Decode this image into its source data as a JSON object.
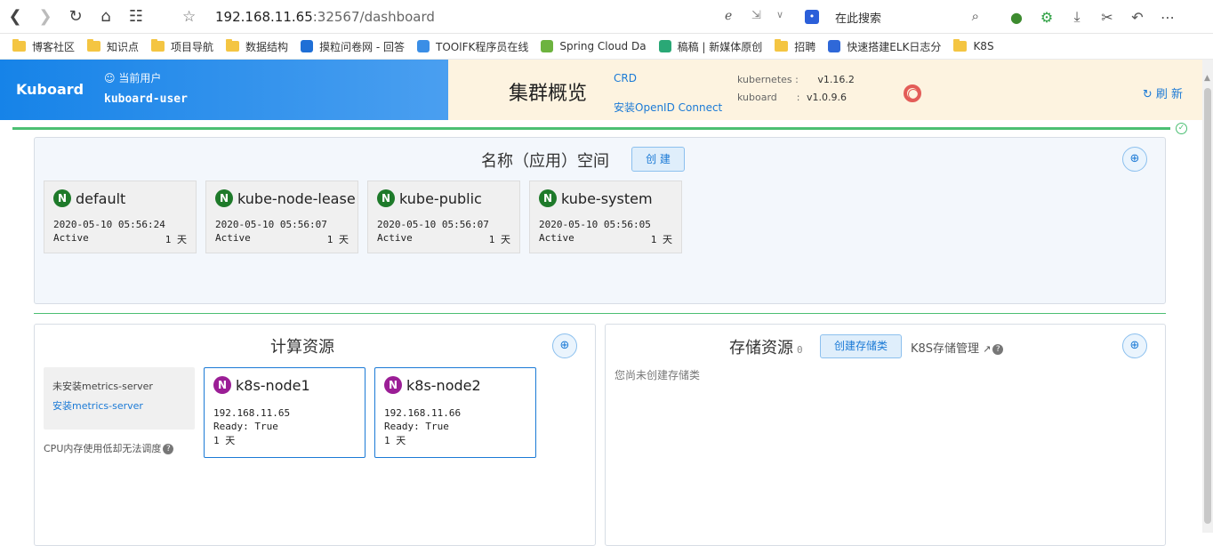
{
  "browser": {
    "url_host": "192.168.11.65",
    "url_rest": ":32567/dashboard",
    "search_placeholder": "在此搜索",
    "bookmarks": [
      {
        "label": "博客社区",
        "type": "folder"
      },
      {
        "label": "知识点",
        "type": "folder"
      },
      {
        "label": "项目导航",
        "type": "folder"
      },
      {
        "label": "数据结构",
        "type": "folder"
      },
      {
        "label": "摸粒问卷网 - 回答",
        "type": "site",
        "color": "#1f6fd6"
      },
      {
        "label": "TOOlFK程序员在线",
        "type": "site",
        "color": "#3a8ee6"
      },
      {
        "label": "Spring Cloud Da",
        "type": "site",
        "color": "#6db33f"
      },
      {
        "label": "稿稿 | 新媒体原创",
        "type": "site",
        "color": "#2aa876"
      },
      {
        "label": "招聘",
        "type": "folder"
      },
      {
        "label": "快速搭建ELK日志分",
        "type": "site",
        "color": "#2f68d8"
      },
      {
        "label": "K8S",
        "type": "folder"
      }
    ]
  },
  "header": {
    "brand": "Kuboard",
    "user_label": "当前用户",
    "user_name": "kuboard-user",
    "page_title": "集群概览",
    "crd_link": "CRD",
    "oidc_link": "安装OpenID Connect",
    "kubernetes_label": "kubernetes",
    "kubernetes_version": "v1.16.2",
    "kuboard_label": "kuboard",
    "kuboard_version": "v1.0.9.6",
    "refresh_label": "刷 新"
  },
  "namespaces": {
    "title": "名称（应用）空间",
    "create_label": "创 建",
    "items": [
      {
        "badge": "N",
        "name": "default",
        "created": "2020-05-10 05:56:24",
        "status": "Active",
        "age": "1 天"
      },
      {
        "badge": "N",
        "name": "kube-node-lease",
        "created": "2020-05-10 05:56:07",
        "status": "Active",
        "age": "1 天"
      },
      {
        "badge": "N",
        "name": "kube-public",
        "created": "2020-05-10 05:56:07",
        "status": "Active",
        "age": "1 天"
      },
      {
        "badge": "N",
        "name": "kube-system",
        "created": "2020-05-10 05:56:05",
        "status": "Active",
        "age": "1 天"
      }
    ]
  },
  "compute": {
    "title": "计算资源",
    "metrics_title": "未安装metrics-server",
    "metrics_link": "安装metrics-server",
    "cpu_note": "CPU内存使用低却无法调度",
    "nodes": [
      {
        "badge": "N",
        "name": "k8s-node1",
        "ip": "192.168.11.65",
        "ready": "Ready: True",
        "age": "1 天"
      },
      {
        "badge": "N",
        "name": "k8s-node2",
        "ip": "192.168.11.66",
        "ready": "Ready: True",
        "age": "1 天"
      }
    ]
  },
  "storage": {
    "title": "存储资源",
    "count": "0",
    "create_label": "创建存储类",
    "manage_label": "K8S存储管理",
    "empty_text": "您尚未创建存储类"
  }
}
